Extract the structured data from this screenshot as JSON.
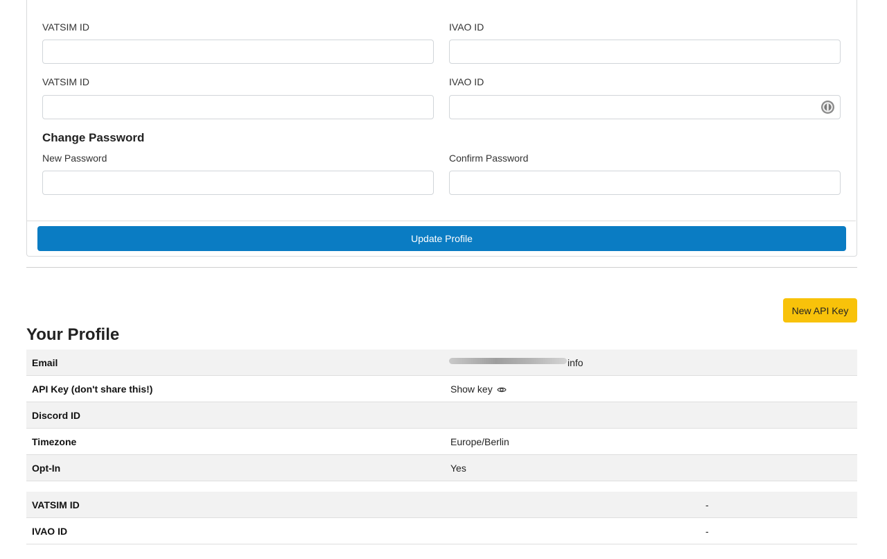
{
  "form": {
    "vatsim_label_1": "VATSIM ID",
    "ivao_label_1": "IVAO ID",
    "vatsim_label_2": "VATSIM ID",
    "ivao_label_2": "IVAO ID",
    "vatsim_value_1": "",
    "ivao_value_1": "",
    "vatsim_value_2": "",
    "ivao_value_2": "",
    "change_password_title": "Change Password",
    "new_password_label": "New Password",
    "confirm_password_label": "Confirm Password",
    "new_password_value": "",
    "confirm_password_value": "",
    "update_button": "Update Profile"
  },
  "actions": {
    "new_api_key": "New API Key"
  },
  "profile": {
    "title": "Your Profile",
    "rows": [
      {
        "key": "Email",
        "value": "info"
      },
      {
        "key": "API Key  (don't share this!)",
        "value": "Show key"
      },
      {
        "key": "Discord ID",
        "value": ""
      },
      {
        "key": "Timezone",
        "value": "Europe/Berlin"
      },
      {
        "key": "Opt-In",
        "value": "Yes"
      }
    ],
    "network_rows": [
      {
        "key": "VATSIM ID",
        "value": "-"
      },
      {
        "key": "IVAO ID",
        "value": "-"
      }
    ]
  },
  "colors": {
    "primary": "#0a7cc3",
    "warning": "#f8c20a",
    "row_shade": "#f2f2f2"
  },
  "icons": {
    "show_key": "eye-icon",
    "password_manager": "password-manager-icon"
  }
}
